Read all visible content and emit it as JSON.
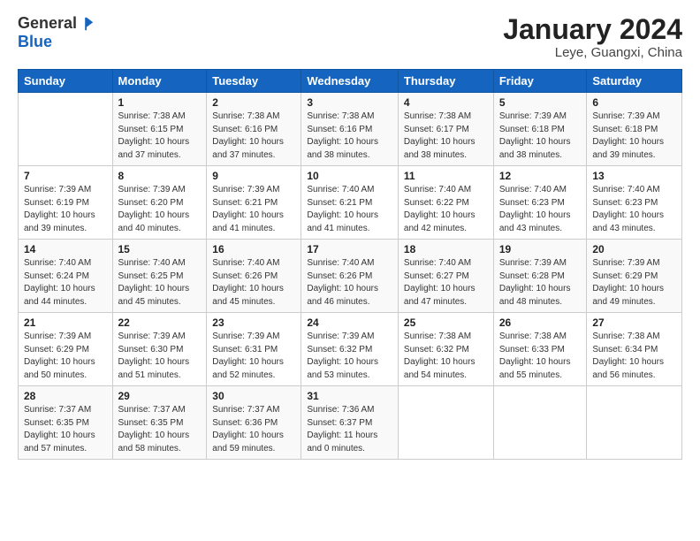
{
  "logo": {
    "general": "General",
    "blue": "Blue"
  },
  "header": {
    "month_year": "January 2024",
    "location": "Leye, Guangxi, China"
  },
  "days_of_week": [
    "Sunday",
    "Monday",
    "Tuesday",
    "Wednesday",
    "Thursday",
    "Friday",
    "Saturday"
  ],
  "weeks": [
    [
      {
        "day": "",
        "sunrise": "",
        "sunset": "",
        "daylight": ""
      },
      {
        "day": "1",
        "sunrise": "Sunrise: 7:38 AM",
        "sunset": "Sunset: 6:15 PM",
        "daylight": "Daylight: 10 hours and 37 minutes."
      },
      {
        "day": "2",
        "sunrise": "Sunrise: 7:38 AM",
        "sunset": "Sunset: 6:16 PM",
        "daylight": "Daylight: 10 hours and 37 minutes."
      },
      {
        "day": "3",
        "sunrise": "Sunrise: 7:38 AM",
        "sunset": "Sunset: 6:16 PM",
        "daylight": "Daylight: 10 hours and 38 minutes."
      },
      {
        "day": "4",
        "sunrise": "Sunrise: 7:38 AM",
        "sunset": "Sunset: 6:17 PM",
        "daylight": "Daylight: 10 hours and 38 minutes."
      },
      {
        "day": "5",
        "sunrise": "Sunrise: 7:39 AM",
        "sunset": "Sunset: 6:18 PM",
        "daylight": "Daylight: 10 hours and 38 minutes."
      },
      {
        "day": "6",
        "sunrise": "Sunrise: 7:39 AM",
        "sunset": "Sunset: 6:18 PM",
        "daylight": "Daylight: 10 hours and 39 minutes."
      }
    ],
    [
      {
        "day": "7",
        "sunrise": "Sunrise: 7:39 AM",
        "sunset": "Sunset: 6:19 PM",
        "daylight": "Daylight: 10 hours and 39 minutes."
      },
      {
        "day": "8",
        "sunrise": "Sunrise: 7:39 AM",
        "sunset": "Sunset: 6:20 PM",
        "daylight": "Daylight: 10 hours and 40 minutes."
      },
      {
        "day": "9",
        "sunrise": "Sunrise: 7:39 AM",
        "sunset": "Sunset: 6:21 PM",
        "daylight": "Daylight: 10 hours and 41 minutes."
      },
      {
        "day": "10",
        "sunrise": "Sunrise: 7:40 AM",
        "sunset": "Sunset: 6:21 PM",
        "daylight": "Daylight: 10 hours and 41 minutes."
      },
      {
        "day": "11",
        "sunrise": "Sunrise: 7:40 AM",
        "sunset": "Sunset: 6:22 PM",
        "daylight": "Daylight: 10 hours and 42 minutes."
      },
      {
        "day": "12",
        "sunrise": "Sunrise: 7:40 AM",
        "sunset": "Sunset: 6:23 PM",
        "daylight": "Daylight: 10 hours and 43 minutes."
      },
      {
        "day": "13",
        "sunrise": "Sunrise: 7:40 AM",
        "sunset": "Sunset: 6:23 PM",
        "daylight": "Daylight: 10 hours and 43 minutes."
      }
    ],
    [
      {
        "day": "14",
        "sunrise": "Sunrise: 7:40 AM",
        "sunset": "Sunset: 6:24 PM",
        "daylight": "Daylight: 10 hours and 44 minutes."
      },
      {
        "day": "15",
        "sunrise": "Sunrise: 7:40 AM",
        "sunset": "Sunset: 6:25 PM",
        "daylight": "Daylight: 10 hours and 45 minutes."
      },
      {
        "day": "16",
        "sunrise": "Sunrise: 7:40 AM",
        "sunset": "Sunset: 6:26 PM",
        "daylight": "Daylight: 10 hours and 45 minutes."
      },
      {
        "day": "17",
        "sunrise": "Sunrise: 7:40 AM",
        "sunset": "Sunset: 6:26 PM",
        "daylight": "Daylight: 10 hours and 46 minutes."
      },
      {
        "day": "18",
        "sunrise": "Sunrise: 7:40 AM",
        "sunset": "Sunset: 6:27 PM",
        "daylight": "Daylight: 10 hours and 47 minutes."
      },
      {
        "day": "19",
        "sunrise": "Sunrise: 7:39 AM",
        "sunset": "Sunset: 6:28 PM",
        "daylight": "Daylight: 10 hours and 48 minutes."
      },
      {
        "day": "20",
        "sunrise": "Sunrise: 7:39 AM",
        "sunset": "Sunset: 6:29 PM",
        "daylight": "Daylight: 10 hours and 49 minutes."
      }
    ],
    [
      {
        "day": "21",
        "sunrise": "Sunrise: 7:39 AM",
        "sunset": "Sunset: 6:29 PM",
        "daylight": "Daylight: 10 hours and 50 minutes."
      },
      {
        "day": "22",
        "sunrise": "Sunrise: 7:39 AM",
        "sunset": "Sunset: 6:30 PM",
        "daylight": "Daylight: 10 hours and 51 minutes."
      },
      {
        "day": "23",
        "sunrise": "Sunrise: 7:39 AM",
        "sunset": "Sunset: 6:31 PM",
        "daylight": "Daylight: 10 hours and 52 minutes."
      },
      {
        "day": "24",
        "sunrise": "Sunrise: 7:39 AM",
        "sunset": "Sunset: 6:32 PM",
        "daylight": "Daylight: 10 hours and 53 minutes."
      },
      {
        "day": "25",
        "sunrise": "Sunrise: 7:38 AM",
        "sunset": "Sunset: 6:32 PM",
        "daylight": "Daylight: 10 hours and 54 minutes."
      },
      {
        "day": "26",
        "sunrise": "Sunrise: 7:38 AM",
        "sunset": "Sunset: 6:33 PM",
        "daylight": "Daylight: 10 hours and 55 minutes."
      },
      {
        "day": "27",
        "sunrise": "Sunrise: 7:38 AM",
        "sunset": "Sunset: 6:34 PM",
        "daylight": "Daylight: 10 hours and 56 minutes."
      }
    ],
    [
      {
        "day": "28",
        "sunrise": "Sunrise: 7:37 AM",
        "sunset": "Sunset: 6:35 PM",
        "daylight": "Daylight: 10 hours and 57 minutes."
      },
      {
        "day": "29",
        "sunrise": "Sunrise: 7:37 AM",
        "sunset": "Sunset: 6:35 PM",
        "daylight": "Daylight: 10 hours and 58 minutes."
      },
      {
        "day": "30",
        "sunrise": "Sunrise: 7:37 AM",
        "sunset": "Sunset: 6:36 PM",
        "daylight": "Daylight: 10 hours and 59 minutes."
      },
      {
        "day": "31",
        "sunrise": "Sunrise: 7:36 AM",
        "sunset": "Sunset: 6:37 PM",
        "daylight": "Daylight: 11 hours and 0 minutes."
      },
      {
        "day": "",
        "sunrise": "",
        "sunset": "",
        "daylight": ""
      },
      {
        "day": "",
        "sunrise": "",
        "sunset": "",
        "daylight": ""
      },
      {
        "day": "",
        "sunrise": "",
        "sunset": "",
        "daylight": ""
      }
    ]
  ]
}
